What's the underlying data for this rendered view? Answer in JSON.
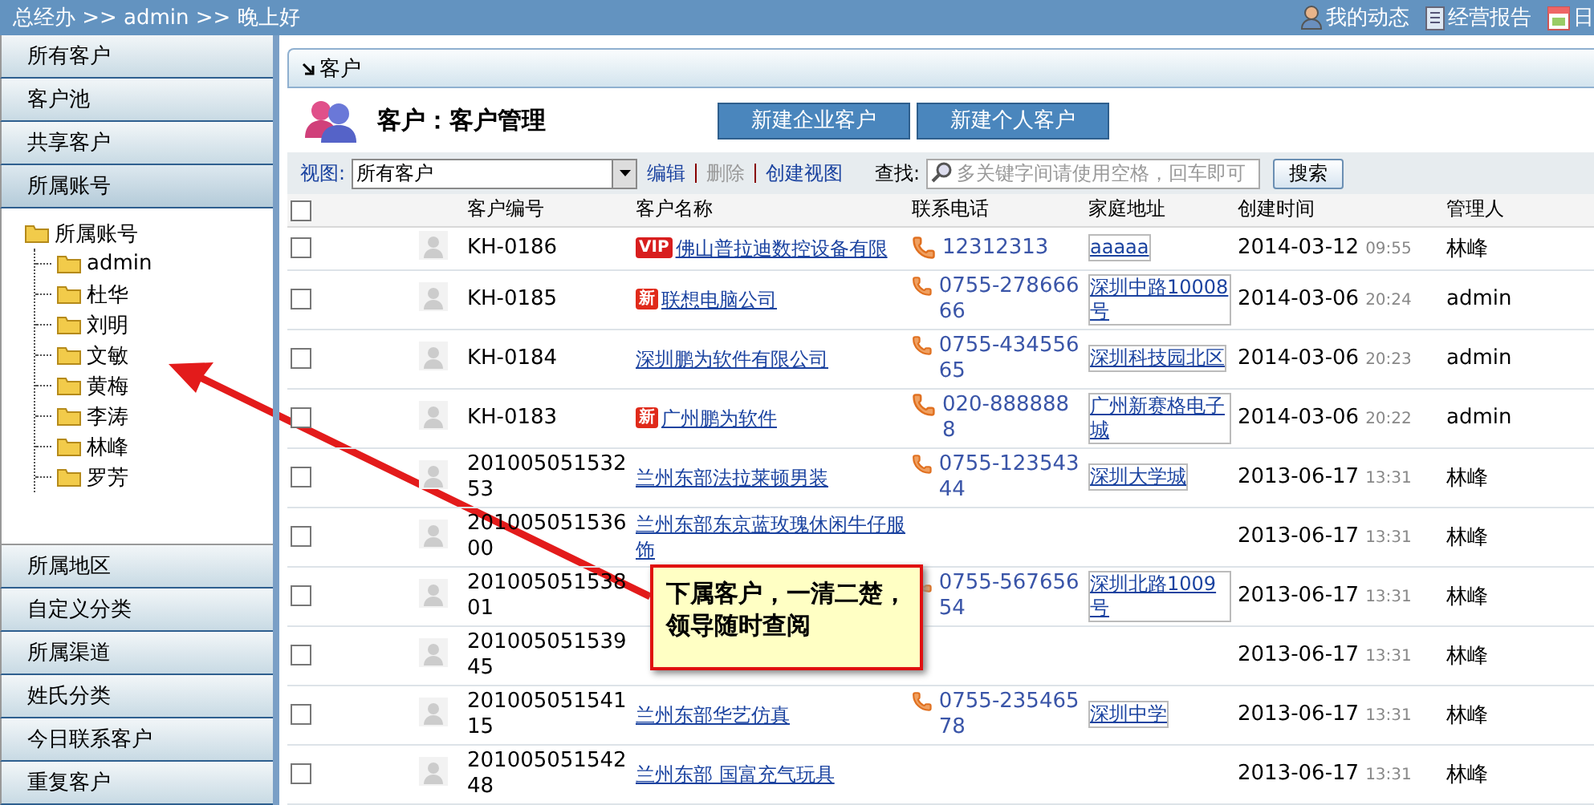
{
  "top_bar": {
    "breadcrumb": "总经办 >> admin >> 晚上好",
    "links": [
      {
        "kind": "person",
        "label": "我的动态"
      },
      {
        "kind": "report",
        "label": "经营报告"
      },
      {
        "kind": "calendar",
        "label": "日"
      }
    ]
  },
  "sidebar": {
    "items": [
      {
        "label": "所有客户",
        "expanded": false
      },
      {
        "label": "客户池",
        "expanded": false
      },
      {
        "label": "共享客户",
        "expanded": false
      },
      {
        "label": "所属账号",
        "expanded": true,
        "tree": {
          "label": "所属账号",
          "children": [
            {
              "label": "admin"
            },
            {
              "label": "杜华"
            },
            {
              "label": "刘明"
            },
            {
              "label": "文敏"
            },
            {
              "label": "黄梅"
            },
            {
              "label": "李涛"
            },
            {
              "label": "林峰"
            },
            {
              "label": "罗芳"
            }
          ]
        }
      },
      {
        "label": "所属地区",
        "expanded": false
      },
      {
        "label": "自定义分类",
        "expanded": false
      },
      {
        "label": "所属渠道",
        "expanded": false
      },
      {
        "label": "姓氏分类",
        "expanded": false
      },
      {
        "label": "今日联系客户",
        "expanded": false
      },
      {
        "label": "重复客户",
        "expanded": false
      }
    ]
  },
  "panel": {
    "title": "客户",
    "heading": "客户：客户管理",
    "buttons": [
      "新建企业客户",
      "新建个人客户"
    ],
    "toolbar": {
      "view_label": "视图:",
      "view_value": "所有客户",
      "actions": [
        {
          "label": "编辑",
          "disabled": false
        },
        {
          "label": "删除",
          "disabled": true
        },
        {
          "label": "创建视图",
          "disabled": false
        }
      ],
      "search_label": "查找:",
      "search_placeholder": "多关键字间请使用空格，回车即可",
      "search_button": "搜索"
    },
    "table": {
      "header_checked": false,
      "columns": [
        "客户编号",
        "客户名称",
        "联系电话",
        "家庭地址",
        "创建时间",
        "管理人"
      ],
      "rows": [
        {
          "checked": false,
          "id": "KH-0186",
          "badge": {
            "kind": "vip",
            "text": "VIP"
          },
          "name": "佛山普拉迪数控设备有限",
          "phone": "12312313",
          "address": "aaaaa",
          "date": "2014-03-12",
          "time": "09:55",
          "manager": "林峰"
        },
        {
          "checked": false,
          "id": "KH-0185",
          "badge": {
            "kind": "new",
            "text": "新"
          },
          "name": "联想电脑公司",
          "phone": "0755-27866666",
          "address": "深圳中路10008号",
          "date": "2014-03-06",
          "time": "20:24",
          "manager": "admin"
        },
        {
          "checked": false,
          "id": "KH-0184",
          "name": "深圳鹏为软件有限公司",
          "phone": "0755-43455665",
          "address": "深圳科技园北区",
          "date": "2014-03-06",
          "time": "20:23",
          "manager": "admin"
        },
        {
          "checked": false,
          "id": "KH-0183",
          "badge": {
            "kind": "new",
            "text": "新"
          },
          "name": "广州鹏为软件",
          "phone": "020-8888888",
          "address": "广州新赛格电子城",
          "date": "2014-03-06",
          "time": "20:22",
          "manager": "admin"
        },
        {
          "checked": false,
          "id": "20100505153253",
          "name": "兰州东部法拉莱顿男装",
          "phone": "0755-12354344",
          "address": "深圳大学城",
          "date": "2013-06-17",
          "time": "13:31",
          "manager": "林峰"
        },
        {
          "checked": false,
          "id": "20100505153600",
          "name": "兰州东部东京蓝玫瑰休闲牛仔服饰",
          "date": "2013-06-17",
          "time": "13:31",
          "manager": "林峰"
        },
        {
          "checked": false,
          "id": "20100505153801",
          "phone": "0755-56765654",
          "address": "深圳北路1009号",
          "date": "2013-06-17",
          "time": "13:31",
          "manager": "林峰"
        },
        {
          "checked": false,
          "id": "20100505153945",
          "date": "2013-06-17",
          "time": "13:31",
          "manager": "林峰"
        },
        {
          "checked": false,
          "id": "20100505154115",
          "name": "兰州东部华艺仿真",
          "phone": "0755-23546578",
          "address": "深圳中学",
          "date": "2013-06-17",
          "time": "13:31",
          "manager": "林峰"
        },
        {
          "checked": false,
          "id": "20100505154248",
          "name": "兰州东部 国富充气玩具",
          "date": "2013-06-17",
          "time": "13:31",
          "manager": "林峰"
        }
      ]
    }
  },
  "callout": {
    "text": "下属客户，一清二楚，领导随时查阅"
  }
}
